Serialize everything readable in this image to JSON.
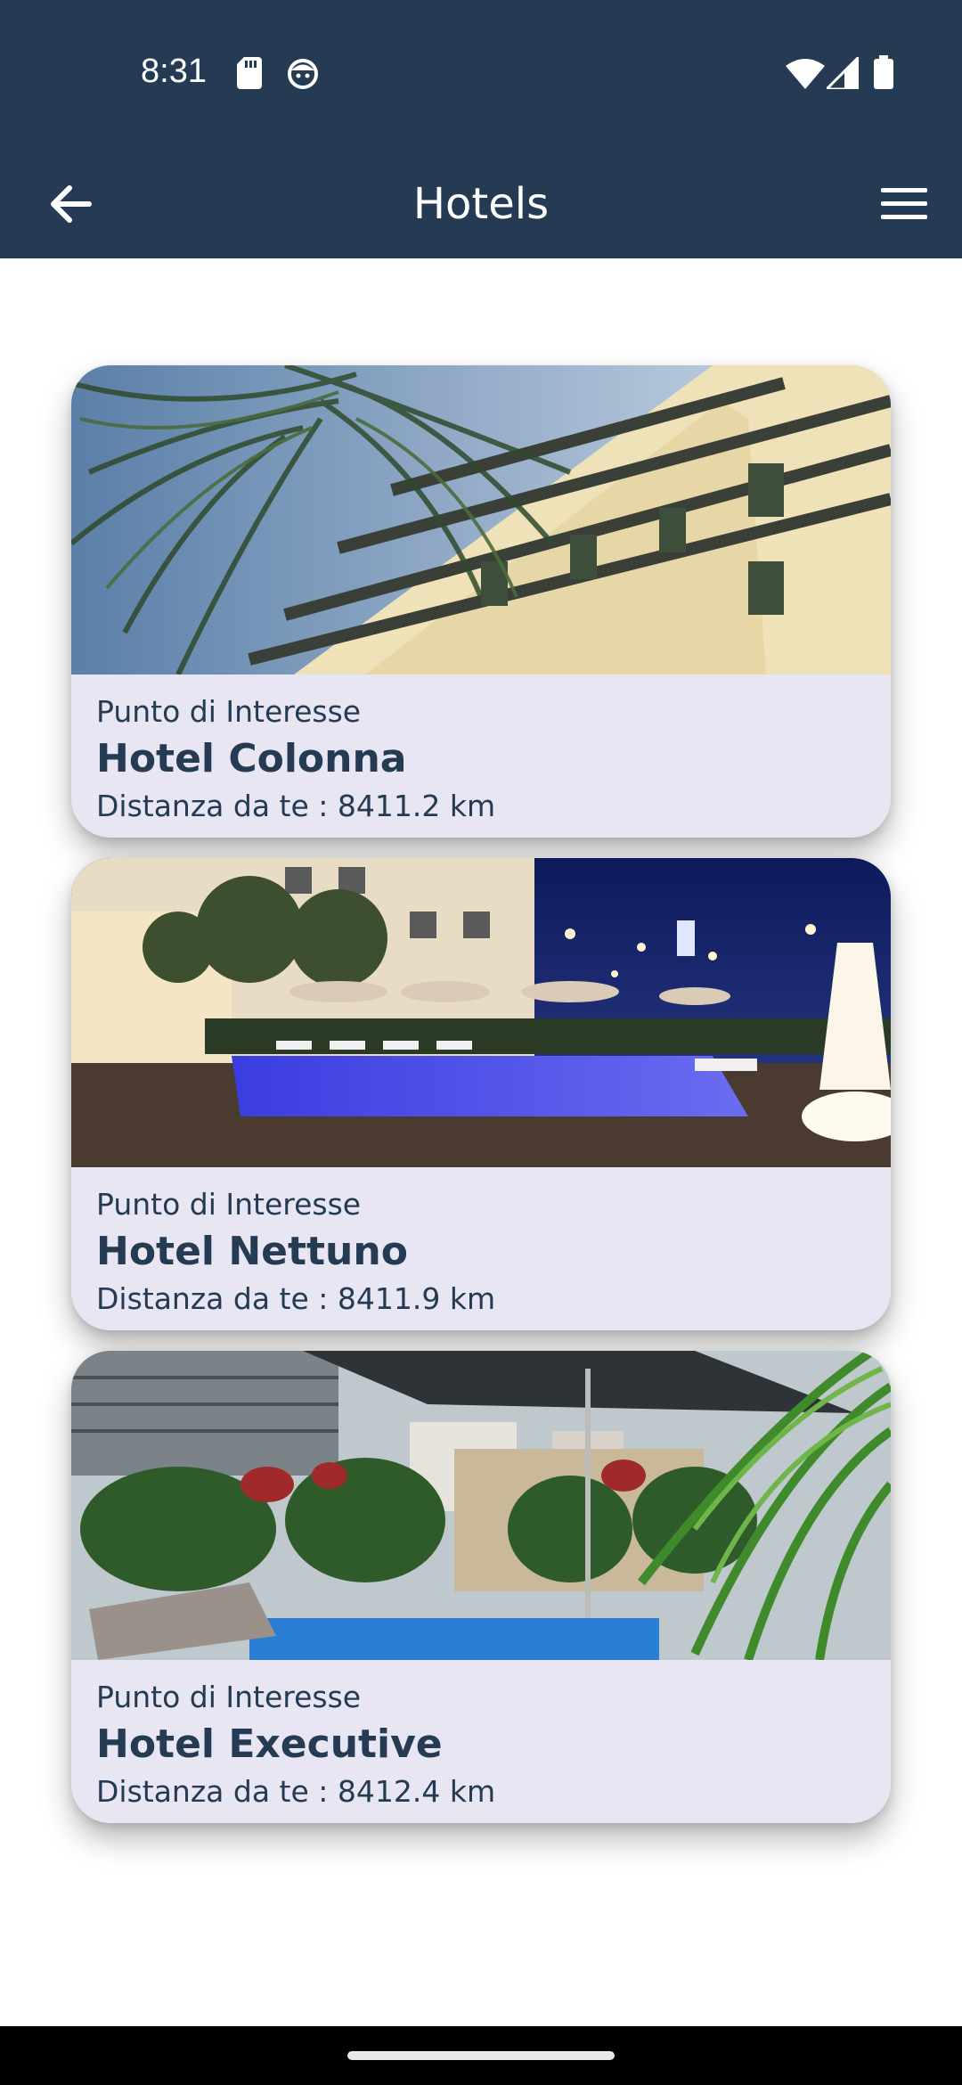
{
  "status_bar": {
    "time": "8:31",
    "icons": [
      "sd-card-icon",
      "face-icon",
      "wifi-icon",
      "signal-icon",
      "battery-icon"
    ]
  },
  "app_bar": {
    "title": "Hotels",
    "back_icon": "arrow-left-icon",
    "menu_icon": "hamburger-menu-icon"
  },
  "colors": {
    "primary": "#243b53",
    "card_background": "#e8e6f2",
    "text": "#243b53"
  },
  "hotels": [
    {
      "type": "Punto di Interesse",
      "name": "Hotel Colonna",
      "distance": "Distanza da te : 8411.2 km",
      "image": "hotel-building-palm-photo"
    },
    {
      "type": "Punto di Interesse",
      "name": "Hotel Nettuno",
      "distance": "Distanza da te : 8411.9 km",
      "image": "hotel-pool-night-photo"
    },
    {
      "type": "Punto di Interesse",
      "name": "Hotel Executive",
      "distance": "Distanza da te : 8412.4 km",
      "image": "hotel-pool-umbrella-photo"
    }
  ]
}
